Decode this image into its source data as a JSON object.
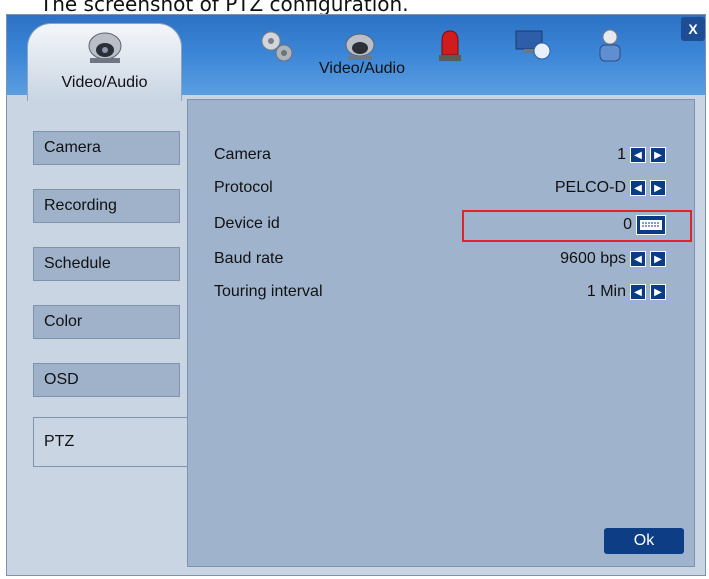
{
  "caption": "The screenshot of PTZ configuration.",
  "window": {
    "close_label": "X",
    "active_tab_label": "Video/Audio",
    "top_video_label": "Video/Audio"
  },
  "sidebar": {
    "items": [
      {
        "label": "Camera"
      },
      {
        "label": "Recording"
      },
      {
        "label": "Schedule"
      },
      {
        "label": "Color"
      },
      {
        "label": "OSD"
      },
      {
        "label": "PTZ"
      }
    ]
  },
  "settings": {
    "camera": {
      "label": "Camera",
      "value": "1"
    },
    "protocol": {
      "label": "Protocol",
      "value": "PELCO-D"
    },
    "device_id": {
      "label": "Device id",
      "value": "0"
    },
    "baud_rate": {
      "label": "Baud rate",
      "value": "9600 bps"
    },
    "touring_interval": {
      "label": "Touring interval",
      "value": "1 Min"
    }
  },
  "buttons": {
    "ok_label": "Ok"
  },
  "colors": {
    "highlight": "#e0242a",
    "arrow_button": "#0a3b86",
    "ok_button": "#0d3d84",
    "topbar": "#3a84d6"
  },
  "icons": [
    "camera-icon",
    "gear-icon",
    "alarm-icon",
    "network-icon",
    "user-icon",
    "close-icon",
    "keyboard-icon"
  ]
}
